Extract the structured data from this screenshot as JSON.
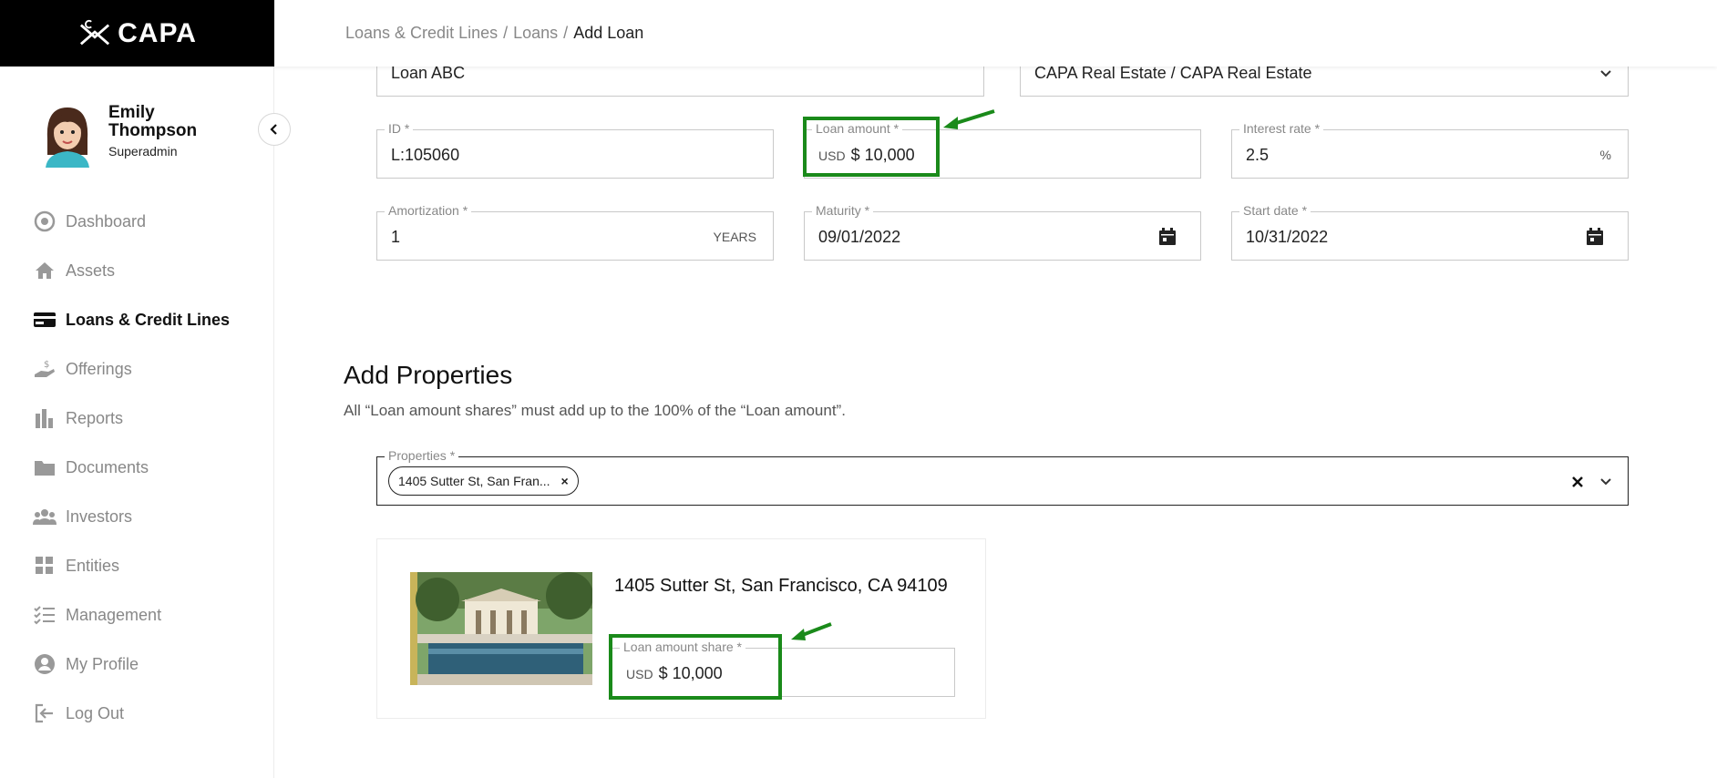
{
  "app": {
    "logo_text": "CAPA"
  },
  "user": {
    "name": "Emily Thompson",
    "role": "Superadmin"
  },
  "nav": [
    {
      "label": "Dashboard",
      "icon": "dashboard-icon"
    },
    {
      "label": "Assets",
      "icon": "home-icon"
    },
    {
      "label": "Loans & Credit Lines",
      "icon": "credit-card-icon",
      "active": true
    },
    {
      "label": "Offerings",
      "icon": "offering-hand-icon"
    },
    {
      "label": "Reports",
      "icon": "bar-chart-icon"
    },
    {
      "label": "Documents",
      "icon": "folder-icon"
    },
    {
      "label": "Investors",
      "icon": "users-icon"
    },
    {
      "label": "Entities",
      "icon": "grid-icon"
    },
    {
      "label": "Management",
      "icon": "checklist-icon"
    },
    {
      "label": "My Profile",
      "icon": "user-circle-icon"
    },
    {
      "label": "Log Out",
      "icon": "logout-icon"
    }
  ],
  "breadcrumb": {
    "items": [
      "Loans & Credit Lines",
      "Loans"
    ],
    "separator": "/",
    "current": "Add Loan"
  },
  "form": {
    "name": {
      "value": "Loan ABC"
    },
    "entity": {
      "value": "CAPA Real Estate / CAPA Real Estate"
    },
    "id": {
      "label": "ID *",
      "value": "L:105060"
    },
    "loan_amount": {
      "label": "Loan amount *",
      "currency": "USD",
      "value": "$ 10,000"
    },
    "interest_rate": {
      "label": "Interest rate *",
      "value": "2.5",
      "suffix": "%"
    },
    "amortization": {
      "label": "Amortization *",
      "value": "1",
      "suffix": "YEARS"
    },
    "maturity": {
      "label": "Maturity *",
      "value": "09/01/2022"
    },
    "start_date": {
      "label": "Start date *",
      "value": "10/31/2022"
    }
  },
  "properties_section": {
    "title": "Add Properties",
    "subtitle": "All “Loan amount shares” must add up to the 100% of the “Loan amount”.",
    "select_label": "Properties *",
    "chip": "1405 Sutter St, San Fran...",
    "card": {
      "address": "1405 Sutter St, San Francisco, CA 94109",
      "share_label": "Loan amount share *",
      "share_currency": "USD",
      "share_value": "$ 10,000"
    }
  },
  "colors": {
    "highlight": "#1a8a1a",
    "sidebar_header": "#000000"
  }
}
